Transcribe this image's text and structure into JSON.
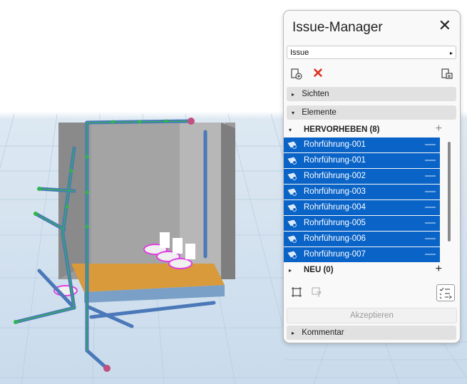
{
  "panel": {
    "title": "Issue-Manager",
    "close_glyph": "✕",
    "issue_select": {
      "value": "Issue",
      "arrow": "▸"
    },
    "toolbar": {
      "new_issue_icon": "new-issue-icon",
      "delete_icon": "delete-icon",
      "export_icon": "export-icon",
      "delete_glyph": "✕"
    },
    "sections": {
      "sichten": {
        "label": "Sichten",
        "arrow": "▸"
      },
      "elemente": {
        "label": "Elemente",
        "arrow": "▾"
      },
      "kommentar": {
        "label": "Kommentar",
        "arrow": "▸"
      }
    },
    "groups": {
      "hervorheben": {
        "label": "HERVORHEBEN (8)",
        "arrow": "▾",
        "action": "+"
      },
      "neu": {
        "label": "NEU (0)",
        "arrow": "▸",
        "action": "+"
      }
    },
    "items": [
      {
        "label": "Rohrführung-001",
        "action": "—"
      },
      {
        "label": "Rohrführung-001",
        "action": "—"
      },
      {
        "label": "Rohrführung-002",
        "action": "—"
      },
      {
        "label": "Rohrführung-003",
        "action": "—"
      },
      {
        "label": "Rohrführung-004",
        "action": "—"
      },
      {
        "label": "Rohrführung-005",
        "action": "—"
      },
      {
        "label": "Rohrführung-006",
        "action": "—"
      },
      {
        "label": "Rohrführung-007",
        "action": "—"
      }
    ],
    "accept_label": "Akzeptieren",
    "colors": {
      "selection": "#0a64c8",
      "delete": "#e0301e",
      "pipe": "#4a78b8",
      "fixture": "#e040e0",
      "floor": "#d89a3a"
    }
  }
}
